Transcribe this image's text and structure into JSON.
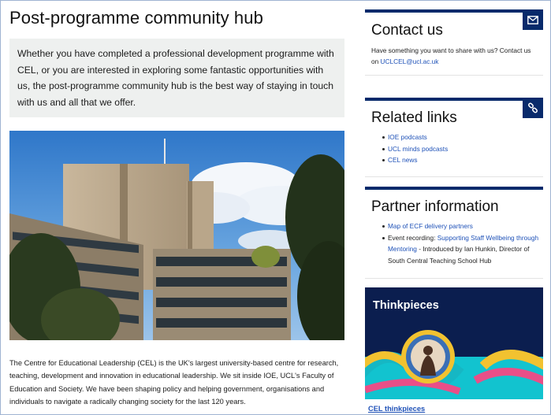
{
  "main": {
    "title": "Post-programme community hub",
    "intro": "Whether you have completed a professional development programme with CEL, or you are interested in exploring some fantastic opportunities with us, the post-programme community hub is the best way of staying in touch with us and all that we offer.",
    "body": "The Centre for Educational Leadership (CEL) is the UK's largest university-based centre for research, teaching, development and innovation in educational leadership. We sit inside IOE, UCL's Faculty of Education and Society. We have been shaping policy and helping government, organisations and individuals to navigate a radically changing society for the last 120 years."
  },
  "sidebar": {
    "contact": {
      "title": "Contact us",
      "text": "Have something you want to share with us? Contact us on ",
      "email": "UCLCEL@ucl.ac.uk",
      "icon": "envelope-icon"
    },
    "related": {
      "title": "Related links",
      "icon": "link-icon",
      "links": [
        "IOE podcasts",
        "UCL minds podcasts",
        "CEL news"
      ]
    },
    "partner": {
      "title": "Partner information",
      "item1_link": "Map of ECF delivery partners",
      "item2_prefix": "Event recording: ",
      "item2_link": "Supporting Staff Wellbeing through Mentoring",
      "item2_suffix": " - Introduced by Ian Hunkin, Director of South Central Teaching School Hub"
    },
    "thinkpieces": {
      "label": "Thinkpieces",
      "link": "CEL thinkpieces"
    }
  },
  "colors": {
    "navy": "#082a6b",
    "link": "#1f52b8",
    "intro_bg": "#eef0ef"
  }
}
